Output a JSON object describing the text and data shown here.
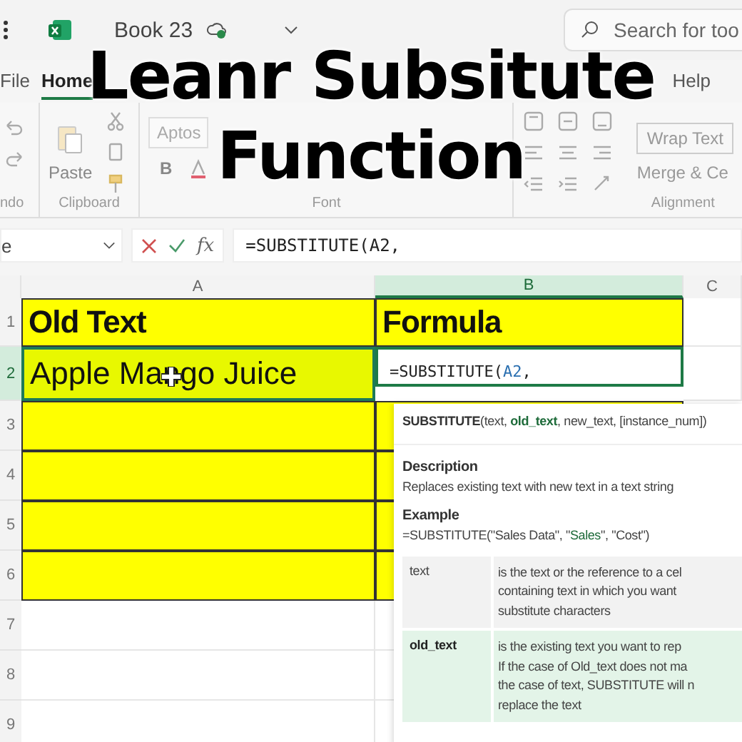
{
  "title_overlay": [
    "Leanr Subsitute",
    "Function"
  ],
  "title_bar": {
    "book": "Book 23",
    "search": {
      "placeholder": "Search for too"
    }
  },
  "ribbon_tabs": [
    {
      "label": "File",
      "selected": false
    },
    {
      "label": "Home",
      "selected": true
    },
    {
      "label": "Help",
      "selected": false
    }
  ],
  "ribbon": {
    "undo_group": "ndo",
    "paste": "Paste",
    "clipboard_group": "Clipboard",
    "font_name": "Aptos",
    "bold": "B",
    "font_group": "Font",
    "wrap_text": "Wrap Text",
    "merge": "Merge & Ce",
    "alignment_group": "Alignment"
  },
  "formula_bar": {
    "name_box": "e",
    "fx": "fx",
    "formula": "=SUBSTITUTE(A2,"
  },
  "columns": [
    {
      "label": "A",
      "selected": false
    },
    {
      "label": "B",
      "selected": true
    },
    {
      "label": "C",
      "selected": false
    }
  ],
  "rows": [
    {
      "number": "1",
      "selected": false,
      "cells": [
        {
          "text": "Old Text",
          "kind": "header"
        },
        {
          "text": "Formula",
          "kind": "header"
        }
      ]
    },
    {
      "number": "2",
      "selected": true,
      "cells": [
        {
          "text": "Apple Mango Juice",
          "kind": "value"
        },
        {
          "kind": "formula",
          "prefix": "=SUBSTITUTE(",
          "ref": "A2",
          "suffix": ","
        }
      ]
    },
    {
      "number": "3",
      "selected": false,
      "cells": [
        {
          "kind": "empty"
        },
        {
          "kind": "empty"
        }
      ]
    },
    {
      "number": "4",
      "selected": false,
      "cells": [
        {
          "kind": "empty"
        },
        {
          "kind": "empty"
        }
      ]
    },
    {
      "number": "5",
      "selected": false,
      "cells": [
        {
          "kind": "empty"
        },
        {
          "kind": "empty"
        }
      ]
    },
    {
      "number": "6",
      "selected": false,
      "cells": [
        {
          "kind": "empty"
        },
        {
          "kind": "empty"
        }
      ]
    },
    {
      "number": "7",
      "selected": false,
      "cells": [
        {
          "kind": "blank"
        },
        {
          "kind": "blank"
        }
      ]
    },
    {
      "number": "8",
      "selected": false,
      "cells": [
        {
          "kind": "blank"
        },
        {
          "kind": "blank"
        }
      ]
    },
    {
      "number": "9",
      "selected": false,
      "cells": [
        {
          "kind": "blank"
        },
        {
          "kind": "blank"
        }
      ]
    }
  ],
  "tooltip": {
    "signature": [
      {
        "text": "SUBSTITUTE",
        "kind": "name"
      },
      {
        "text": "(text, ",
        "kind": "plain"
      },
      {
        "text": "old_text",
        "kind": "current"
      },
      {
        "text": ", new_text, [instance_num])",
        "kind": "plain"
      }
    ],
    "description_heading": "Description",
    "description": "Replaces existing text with new text in a text string",
    "example_heading": "Example",
    "example": "=SUBSTITUTE(\"Sales Data\", \"**Sales**\", \"Cost\")",
    "arguments": [
      {
        "name": "text",
        "selected": false,
        "description": "is the text or the reference to a cel\ncontaining text in which you want\nsubstitute characters"
      },
      {
        "name": "old_text",
        "selected": true,
        "description": "is the existing text you want to rep\nIf the case of Old_text does not ma\nthe case of text, SUBSTITUTE will n\nreplace the text"
      }
    ]
  }
}
